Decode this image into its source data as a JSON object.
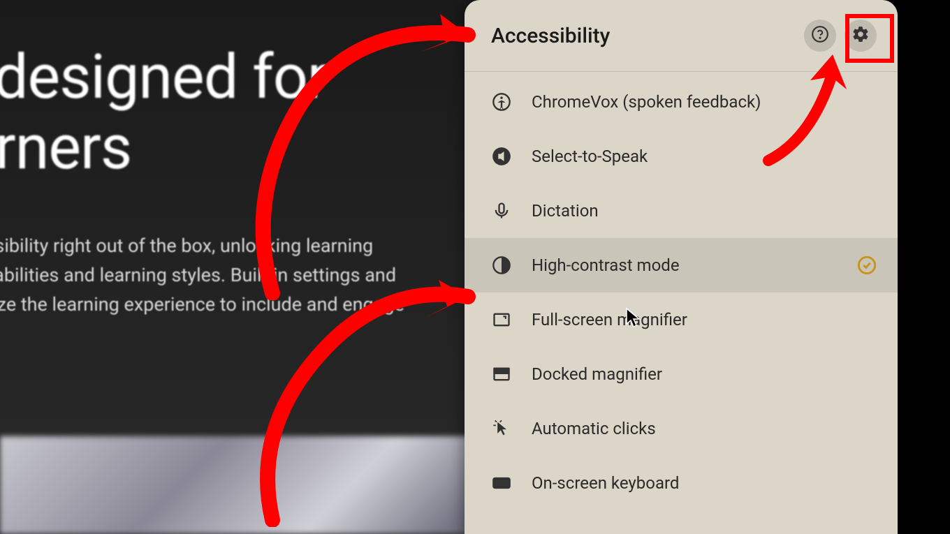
{
  "background": {
    "title_line1": "es designed for",
    "title_line2": "learners",
    "body_line1": "cessibility right out of the box, unlocking learning",
    "body_line2": "ds, abilities and learning styles. Built-in settings and",
    "body_line3": "omize the learning experience to include and engage"
  },
  "panel": {
    "title": "Accessibility",
    "items": [
      {
        "label": "ChromeVox (spoken feedback)",
        "icon": "accessibility-voice"
      },
      {
        "label": "Select-to-Speak",
        "icon": "speak"
      },
      {
        "label": "Dictation",
        "icon": "mic"
      },
      {
        "label": "High-contrast mode",
        "icon": "contrast",
        "checked": true,
        "highlighted": true
      },
      {
        "label": "Full-screen magnifier",
        "icon": "fullscreen"
      },
      {
        "label": "Docked magnifier",
        "icon": "docked"
      },
      {
        "label": "Automatic clicks",
        "icon": "autoclick"
      },
      {
        "label": "On-screen keyboard",
        "icon": "keyboard"
      }
    ]
  },
  "annotations": {
    "highlight_color": "#ff0000"
  }
}
